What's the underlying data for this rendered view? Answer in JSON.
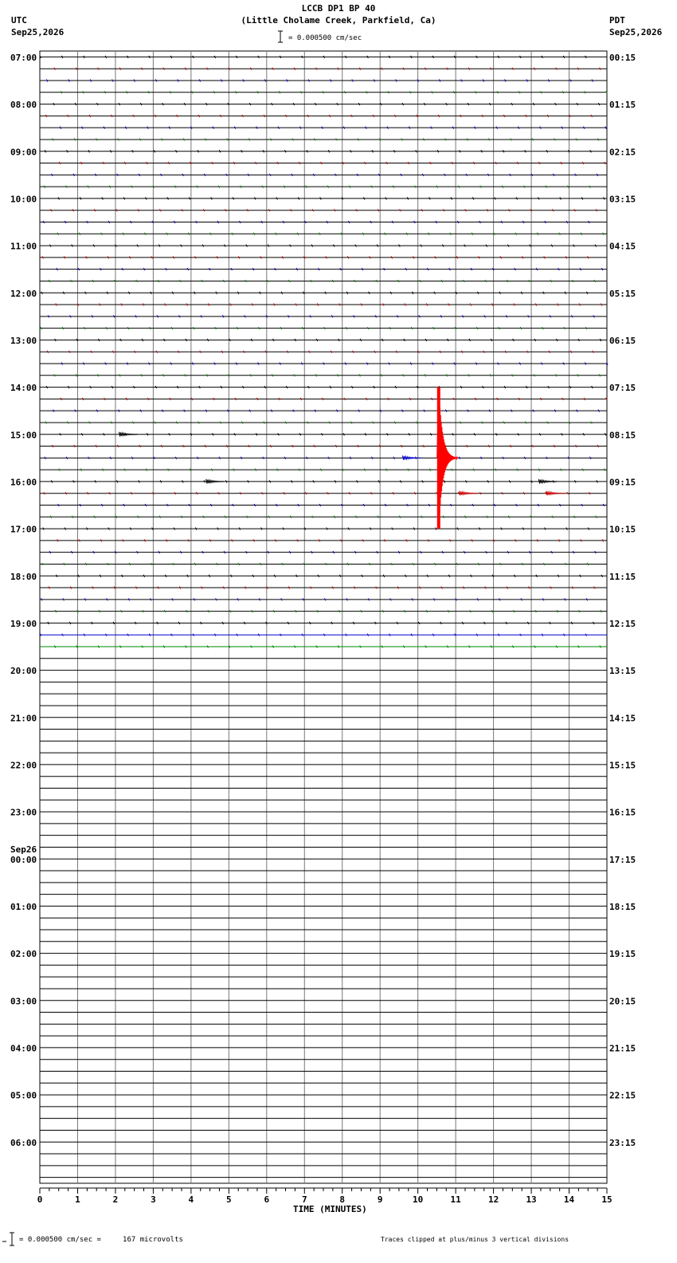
{
  "header": {
    "title": "LCCB DP1 BP 40",
    "subtitle": "(Little Cholame Creek, Parkfield, Ca)",
    "scale": "= 0.000500 cm/sec",
    "left_tz": "UTC",
    "left_date": "Sep25,2026",
    "right_tz": "PDT",
    "right_date": "Sep25,2026"
  },
  "footer": {
    "scale_text": "= 0.000500 cm/sec =     167 microvolts",
    "clip_note": "Traces clipped at plus/minus 3 vertical divisions"
  },
  "chart_data": {
    "type": "seismogram",
    "xlabel": "TIME (MINUTES)",
    "xlim": [
      0,
      15
    ],
    "x_ticks": [
      "0",
      "1",
      "2",
      "3",
      "4",
      "5",
      "6",
      "7",
      "8",
      "9",
      "10",
      "11",
      "12",
      "13",
      "14",
      "15"
    ],
    "left_hour_labels": [
      "07:00",
      "08:00",
      "09:00",
      "10:00",
      "11:00",
      "12:00",
      "13:00",
      "14:00",
      "15:00",
      "16:00",
      "17:00",
      "18:00",
      "19:00",
      "20:00",
      "21:00",
      "22:00",
      "23:00",
      "00:00",
      "01:00",
      "02:00",
      "03:00",
      "04:00",
      "05:00",
      "06:00"
    ],
    "date_change": {
      "label": "Sep26",
      "hour_index": 17
    },
    "right_hour_labels": [
      "00:15",
      "01:15",
      "02:15",
      "03:15",
      "04:15",
      "05:15",
      "06:15",
      "07:15",
      "08:15",
      "09:15",
      "10:15",
      "11:15",
      "12:15",
      "13:15",
      "14:15",
      "15:15",
      "16:15",
      "17:15",
      "18:15",
      "19:15",
      "20:15",
      "21:15",
      "22:15",
      "23:15"
    ],
    "traces_per_hour": 4,
    "trace_colors": [
      "#000000",
      "#cc0000",
      "#0000cc",
      "#008800"
    ],
    "active_traces": 51,
    "events": [
      {
        "trace": 32,
        "minute": 2.1,
        "color": "#000000",
        "amplitude": "small"
      },
      {
        "trace": 34,
        "minute": 10.55,
        "color": "#ff0000",
        "amplitude": "clipped"
      },
      {
        "trace": 34,
        "minute": 9.6,
        "color": "#0000cc",
        "amplitude": "small"
      },
      {
        "trace": 36,
        "minute": 4.4,
        "color": "#000000",
        "amplitude": "small"
      },
      {
        "trace": 36,
        "minute": 13.2,
        "color": "#000000",
        "amplitude": "small"
      },
      {
        "trace": 37,
        "minute": 11.1,
        "color": "#cc0000",
        "amplitude": "small"
      },
      {
        "trace": 37,
        "minute": 13.4,
        "color": "#cc0000",
        "amplitude": "small"
      }
    ]
  }
}
